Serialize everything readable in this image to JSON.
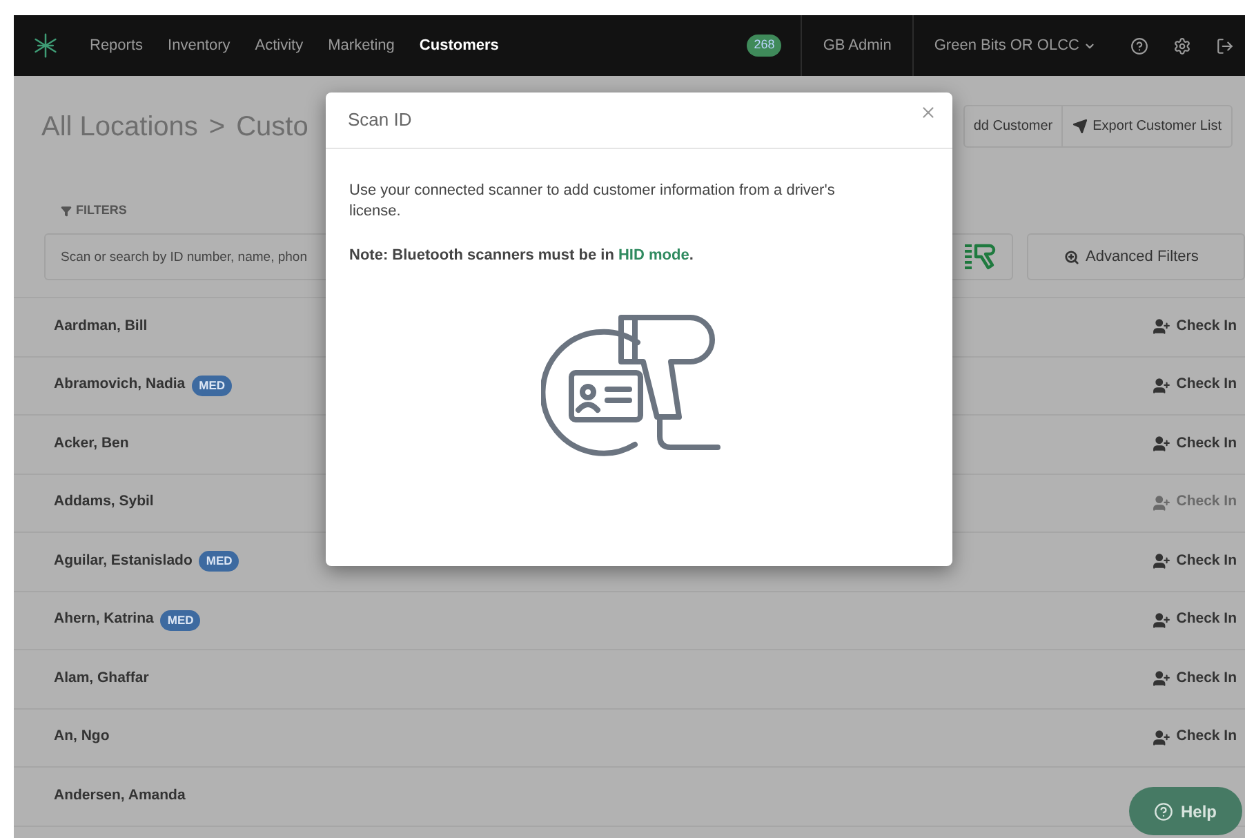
{
  "nav": {
    "items": [
      {
        "label": "Reports",
        "selected": false
      },
      {
        "label": "Inventory",
        "selected": false
      },
      {
        "label": "Activity",
        "selected": false
      },
      {
        "label": "Marketing",
        "selected": false
      },
      {
        "label": "Customers",
        "selected": true
      }
    ],
    "badge": "268",
    "user": "GB Admin",
    "location": "Green Bits OR OLCC"
  },
  "page": {
    "breadcrumb": {
      "items": [
        "All Locations",
        "Custo"
      ],
      "separator": ">"
    },
    "buttons": [
      "dd Customer",
      "Export Customer List"
    ],
    "filters_label": "FILTERS",
    "search": {
      "placeholder": "Scan or search by ID number, name, phon"
    },
    "advanced_filters": "Advanced Filters"
  },
  "customers": [
    {
      "name": "Aardman, Bill",
      "check_in": {
        "label": "Check In",
        "disabled": false
      }
    },
    {
      "name": "Abramovich, Nadia",
      "badge": "MED",
      "check_in": {
        "label": "Check In",
        "disabled": false
      }
    },
    {
      "name": "Acker, Ben",
      "check_in": {
        "label": "Check In",
        "disabled": false
      }
    },
    {
      "name": "Addams, Sybil",
      "check_in": {
        "label": "Check In",
        "disabled": true
      }
    },
    {
      "name": "Aguilar, Estanislado",
      "badge": "MED",
      "check_in": {
        "label": "Check In",
        "disabled": false
      }
    },
    {
      "name": "Ahern, Katrina",
      "badge": "MED",
      "check_in": {
        "label": "Check In",
        "disabled": false
      }
    },
    {
      "name": "Alam, Ghaffar",
      "check_in": {
        "label": "Check In",
        "disabled": false
      }
    },
    {
      "name": "An, Ngo",
      "check_in": {
        "label": "Check In",
        "disabled": false
      }
    },
    {
      "name": "Andersen, Amanda"
    }
  ],
  "modal": {
    "title": "Scan ID",
    "body": "Use your connected scanner to add customer information from a driver's license.",
    "note": "Note: Bluetooth scanners must be in ",
    "link": "HID mode",
    "note_end": "."
  },
  "help": "Help"
}
